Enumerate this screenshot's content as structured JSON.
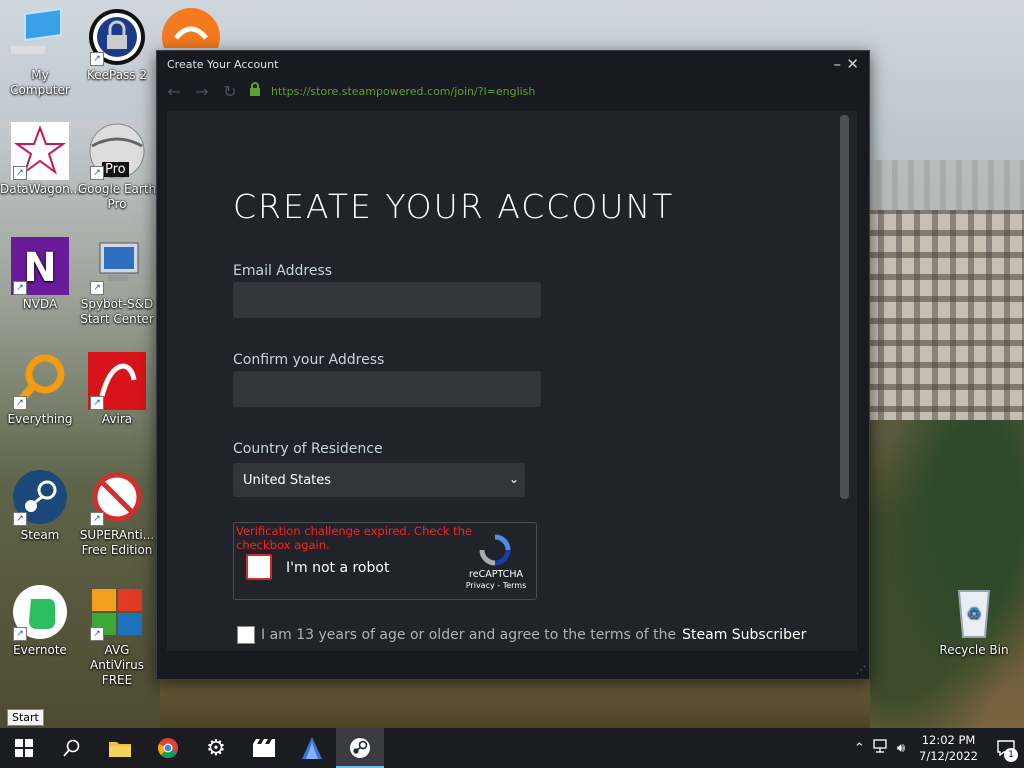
{
  "desktop": {
    "icons": [
      {
        "label": "My Computer"
      },
      {
        "label": "KeePass 2"
      },
      {
        "label": "DataWagon..."
      },
      {
        "label": "Google Earth Pro"
      },
      {
        "label": "NVDA"
      },
      {
        "label": "Spybot-S&D Start Center"
      },
      {
        "label": "Everything"
      },
      {
        "label": "Avira"
      },
      {
        "label": "Steam"
      },
      {
        "label": "SUPERAnti... Free Edition"
      },
      {
        "label": "Evernote"
      },
      {
        "label": "AVG AntiVirus FREE"
      },
      {
        "label": "Recycle Bin"
      }
    ],
    "google_earth_badge": "Pro"
  },
  "window": {
    "title": "Create Your Account",
    "url": "https://store.steampowered.com/join/?l=english",
    "heading": "CREATE YOUR ACCOUNT",
    "email_label": "Email Address",
    "email_value": "",
    "confirm_label": "Confirm your Address",
    "confirm_value": "",
    "country_label": "Country of Residence",
    "country_value": "United States",
    "captcha": {
      "error": "Verification challenge expired. Check the checkbox again.",
      "checkbox_label": "I'm not a robot",
      "brand": "reCAPTCHA",
      "links": "Privacy - Terms"
    },
    "agree_text": "I am 13 years of age or older and agree to the terms of the",
    "agree_link": "Steam Subscriber"
  },
  "tooltip": "Start",
  "taskbar": {
    "items": [
      "start-button",
      "search-icon",
      "file-explorer-icon",
      "chrome-icon",
      "settings-icon",
      "media-icon",
      "app-icon",
      "steam-icon"
    ],
    "clock_time": "12:02 PM",
    "clock_date": "7/12/2022",
    "notification_count": "1"
  },
  "colors": {
    "accent": "#5ba32b",
    "error": "#ff2020",
    "window_bg": "#171a21",
    "field_bg": "#32353c"
  }
}
